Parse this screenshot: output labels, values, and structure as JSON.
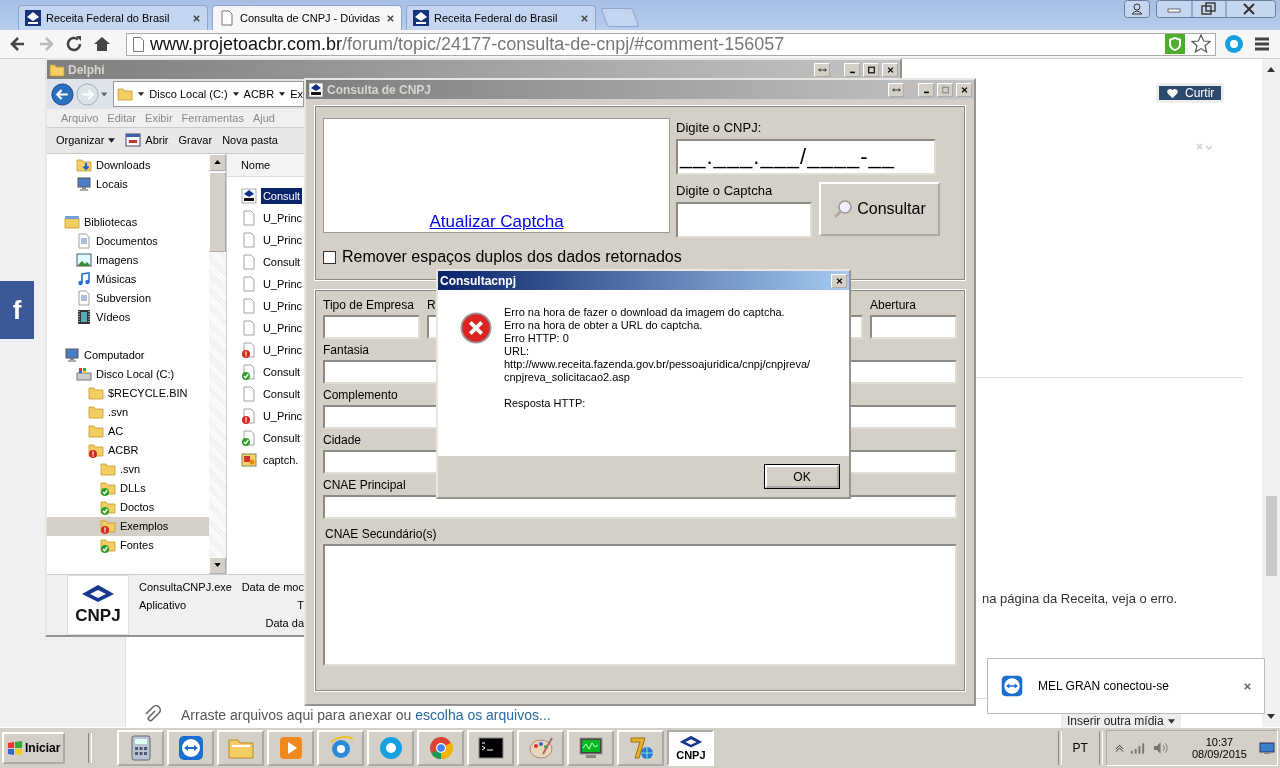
{
  "browser": {
    "tabs": [
      {
        "title": "Receita Federal do Brasil",
        "kind": "site",
        "selected": false
      },
      {
        "title": "Consulta de CNPJ - Dúvidas",
        "kind": "page",
        "selected": true
      },
      {
        "title": "Receita Federal do Brasil",
        "kind": "site",
        "selected": false
      }
    ],
    "address": {
      "domain": "www.projetoacbr.com.br",
      "path": "/forum/topic/24177-consulta-de-cnpj/#comment-156057"
    }
  },
  "page": {
    "like_button": "Curtir",
    "facebook_button": "f",
    "post_fragment": "na página da Receita, veja o erro.",
    "attach": {
      "text": "Arraste arquivos aqui para anexar ou ",
      "link": "escolha os arquivos..."
    },
    "insert_media": "Inserir outra mídia"
  },
  "explorer": {
    "title": "Delphi",
    "breadcrumb": [
      "Disco Local (C:)",
      "ACBR",
      "Ex"
    ],
    "menu": [
      "Arquivo",
      "Editar",
      "Exibir",
      "Ferramentas",
      "Ajud"
    ],
    "commands": [
      {
        "label": "Organizar",
        "kind": "menu"
      },
      {
        "label": "Abrir",
        "kind": "icon"
      },
      {
        "label": "Gravar",
        "kind": "plain"
      },
      {
        "label": "Nova pasta",
        "kind": "plain"
      }
    ],
    "tree": [
      [
        {
          "label": "Downloads",
          "kind": "download",
          "ok": false,
          "error": false,
          "selected": false
        },
        {
          "label": "Locais",
          "kind": "places",
          "ok": false,
          "error": false,
          "selected": false
        }
      ],
      [
        {
          "label": "Bibliotecas",
          "kind": "library",
          "ok": false,
          "error": false,
          "selected": false,
          "children": [
            {
              "label": "Documentos",
              "kind": "documents",
              "ok": false,
              "error": false,
              "selected": false
            },
            {
              "label": "Imagens",
              "kind": "images",
              "ok": false,
              "error": false,
              "selected": false
            },
            {
              "label": "Músicas",
              "kind": "music",
              "ok": false,
              "error": false,
              "selected": false
            },
            {
              "label": "Subversion",
              "kind": "documents",
              "ok": false,
              "error": false,
              "selected": false
            },
            {
              "label": "Vídeos",
              "kind": "videos",
              "ok": false,
              "error": false,
              "selected": false
            }
          ]
        }
      ],
      [
        {
          "label": "Computador",
          "kind": "computer",
          "ok": false,
          "error": false,
          "selected": false,
          "children": [
            {
              "label": "Disco Local (C:)",
              "kind": "drive",
              "ok": false,
              "error": false,
              "selected": false,
              "children": [
                {
                  "label": "$RECYCLE.BIN",
                  "kind": "folder",
                  "ok": false,
                  "error": false,
                  "selected": false
                },
                {
                  "label": ".svn",
                  "kind": "folder",
                  "ok": false,
                  "error": false,
                  "selected": false
                },
                {
                  "label": "AC",
                  "kind": "folder",
                  "ok": false,
                  "error": false,
                  "selected": false
                },
                {
                  "label": "ACBR",
                  "kind": "folder",
                  "ok": false,
                  "error": true,
                  "selected": false,
                  "children": [
                    {
                      "label": ".svn",
                      "kind": "folder",
                      "ok": false,
                      "error": false,
                      "selected": false
                    },
                    {
                      "label": "DLLs",
                      "kind": "folder",
                      "ok": true,
                      "error": false,
                      "selected": false
                    },
                    {
                      "label": "Doctos",
                      "kind": "folder",
                      "ok": true,
                      "error": false,
                      "selected": false
                    },
                    {
                      "label": "Exemplos",
                      "kind": "folder",
                      "ok": false,
                      "error": true,
                      "selected": true
                    },
                    {
                      "label": "Fontes",
                      "kind": "folder",
                      "ok": true,
                      "error": false,
                      "selected": false
                    }
                  ]
                }
              ]
            }
          ]
        }
      ]
    ],
    "column": "Nome",
    "files": [
      {
        "name": "Consult",
        "kind": "exe",
        "selected": true
      },
      {
        "name": "U_Princ",
        "kind": "file",
        "selected": false
      },
      {
        "name": "U_Princ",
        "kind": "file",
        "selected": false
      },
      {
        "name": "Consult",
        "kind": "file",
        "selected": false
      },
      {
        "name": "U_Princ",
        "kind": "file",
        "selected": false
      },
      {
        "name": "U_Princ",
        "kind": "file",
        "selected": false
      },
      {
        "name": "U_Princ",
        "kind": "file",
        "selected": false
      },
      {
        "name": "U_Princ",
        "kind": "file-error",
        "selected": false
      },
      {
        "name": "Consult",
        "kind": "file-ok",
        "selected": false
      },
      {
        "name": "Consult",
        "kind": "file",
        "selected": false
      },
      {
        "name": "U_Princ",
        "kind": "file-error",
        "selected": false
      },
      {
        "name": "Consult",
        "kind": "file-ok",
        "selected": false
      },
      {
        "name": "captch.",
        "kind": "image",
        "selected": false
      }
    ],
    "details": {
      "logo": "CNPJ",
      "name": "ConsultaCNPJ.exe",
      "type": "Aplicativo",
      "field_1": "Data de moc",
      "field_2": "T",
      "field_3": "Data da"
    }
  },
  "cnpj_window": {
    "title": "Consulta de CNPJ",
    "captcha_link": "Atualizar Captcha",
    "cnpj_label": "Digite o CNPJ:",
    "cnpj_value": "__.___.___/____-__",
    "captcha_label": "Digite o Captcha",
    "search_button": "Consultar",
    "remove_spaces": {
      "label": "Remover espaços duplos dos dados retornados",
      "checked": false
    },
    "row_labels": [
      "Tipo de Empresa",
      "R",
      "Abertura"
    ],
    "fields": [
      "Fantasia",
      "Complemento",
      "Cidade",
      "CNAE Principal"
    ],
    "secondary_label": "CNAE Secundário(s)"
  },
  "dialog": {
    "title": "Consultacnpj",
    "message": [
      "Erro na hora de fazer o download da imagem do captcha.",
      "Erro na hora de obter a URL do captcha.",
      "Erro HTTP: 0",
      "URL:",
      "http://www.receita.fazenda.gov.br/pessoajuridica/cnpj/cnpjreva/",
      "cnpjreva_solicitacao2.asp"
    ],
    "response_label": "Resposta HTTP:",
    "ok_button": "OK"
  },
  "toast": {
    "text": "MEL GRAN conectou-se"
  },
  "taskbar": {
    "start": "Iniciar",
    "apps": [
      {
        "kind": "calculator",
        "selected": false
      },
      {
        "kind": "remote",
        "selected": false
      },
      {
        "kind": "explorer",
        "selected": false
      },
      {
        "kind": "media",
        "selected": false
      },
      {
        "kind": "ie",
        "selected": false
      },
      {
        "kind": "skype",
        "selected": false
      },
      {
        "kind": "chrome",
        "selected": false
      },
      {
        "kind": "cmd",
        "selected": false
      },
      {
        "kind": "paint",
        "selected": false
      },
      {
        "kind": "monitor",
        "selected": false
      },
      {
        "kind": "archive",
        "selected": false
      },
      {
        "kind": "cnpj",
        "label": "CNPJ",
        "selected": true
      }
    ],
    "language": "PT",
    "time": "10:37",
    "date": "08/09/2015"
  }
}
